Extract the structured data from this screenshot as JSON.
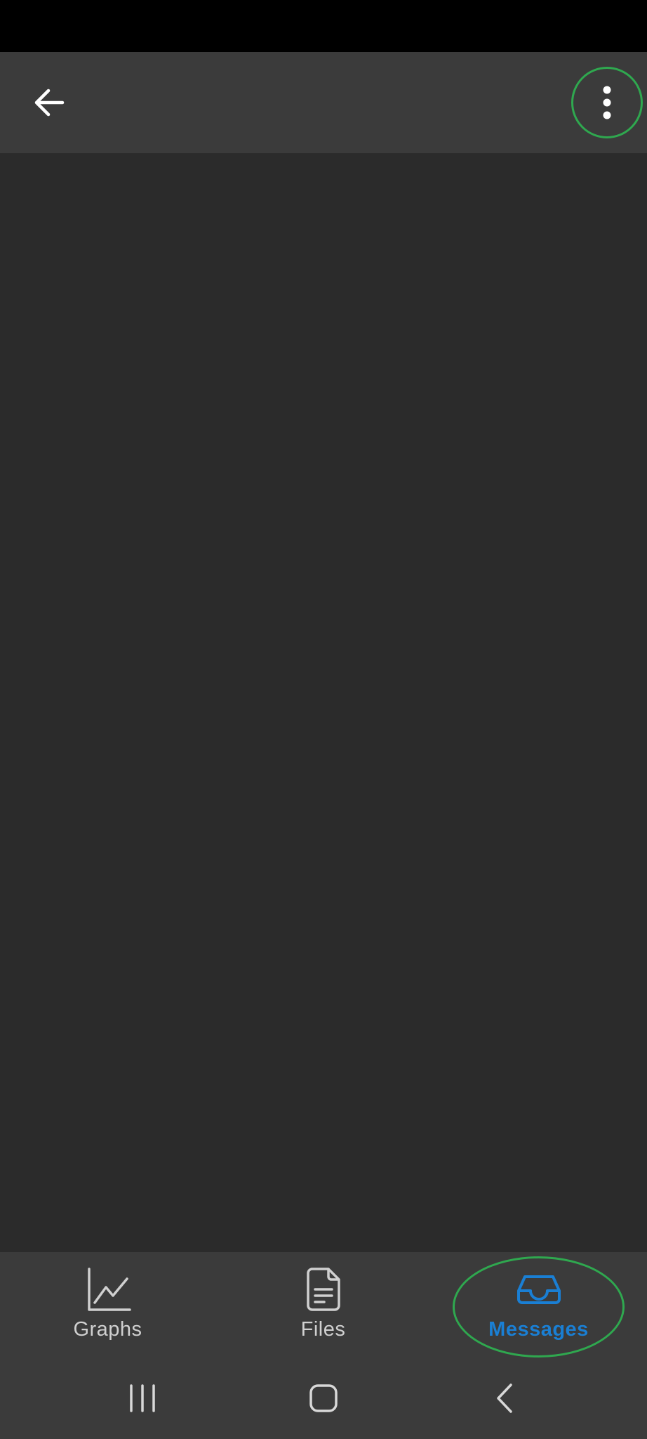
{
  "app_bar": {
    "back_icon": "arrow-left-icon",
    "overflow_icon": "more-vertical-icon"
  },
  "bottom_nav": {
    "items": [
      {
        "label": "Graphs",
        "icon": "chart-line-icon",
        "active": false
      },
      {
        "label": "Files",
        "icon": "file-document-icon",
        "active": false
      },
      {
        "label": "Messages",
        "icon": "inbox-tray-icon",
        "active": true
      }
    ]
  },
  "colors": {
    "status_bar": "#000000",
    "app_bar": "#3b3b3b",
    "content_background": "#2b2b2b",
    "nav_inactive": "#d0d0d0",
    "nav_active": "#1a7fd4",
    "highlight": "#2fa84f"
  },
  "system_nav": {
    "recents_icon": "recents-icon",
    "home_icon": "home-icon",
    "back_icon": "chevron-left-icon"
  }
}
